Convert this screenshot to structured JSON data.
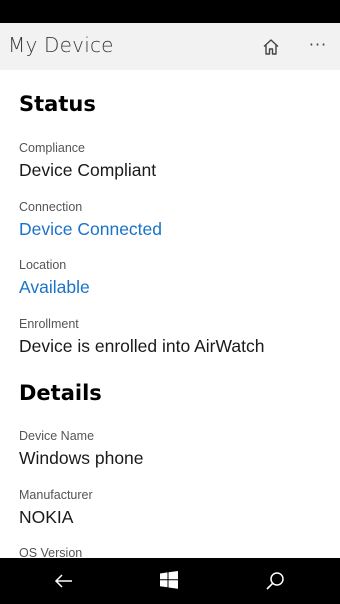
{
  "header": {
    "title": "My Device",
    "home_icon": "home-icon",
    "more_label": "···"
  },
  "status": {
    "title": "Status",
    "compliance": {
      "label": "Compliance",
      "value": "Device Compliant"
    },
    "connection": {
      "label": "Connection",
      "value": "Device Connected"
    },
    "location": {
      "label": "Location",
      "value": "Available"
    },
    "enrollment": {
      "label": "Enrollment",
      "value": "Device is enrolled into AirWatch"
    }
  },
  "details": {
    "title": "Details",
    "device_name": {
      "label": "Device Name",
      "value": "Windows phone"
    },
    "manufacturer": {
      "label": "Manufacturer",
      "value": "NOKIA"
    },
    "os_version": {
      "label": "OS Version"
    }
  },
  "navbar": {
    "back_icon": "back-arrow-icon",
    "windows_icon": "windows-logo-icon",
    "search_icon": "search-icon"
  },
  "colors": {
    "link": "#1a73c9",
    "titlebar_bg": "#f2f2f2"
  }
}
